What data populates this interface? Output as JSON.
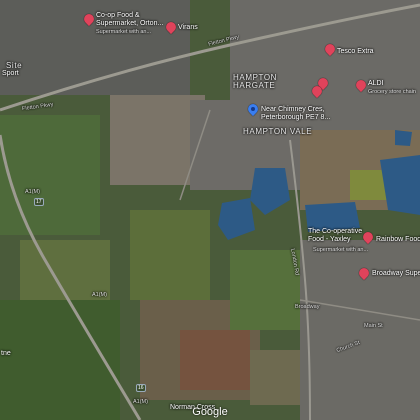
{
  "areas": {
    "hampton_hargate": "HAMPTON\nHARGATE",
    "hampton_vale": "HAMPTON VALE",
    "site": "Site",
    "ort_left": "tne",
    "norman_cross": "Norman Cross"
  },
  "roads": {
    "fletton_pkwy_n": "Fletton Pkwy",
    "fletton_pkwy_w": "Fletton Pkwy",
    "a1m_1": "A1(M)",
    "a1m_2": "A1(M)",
    "a1m_3": "A1(M)",
    "london_rd": "London Rd",
    "broadway": "Broadway",
    "main_st": "Main St",
    "church_st": "Church St",
    "shield_17": "17",
    "shield_16": "16"
  },
  "places": {
    "coop_orton": "Co-op Food &\nSupermarket, Orton...",
    "coop_orton_sub": "Supermarket with an...",
    "virans": "Virans",
    "tesco": "Tesco Extra",
    "aldi": "ALDI",
    "aldi_sub": "Grocery store chain",
    "coop_yaxley": "The Co-operative\nFood - Yaxley",
    "coop_yaxley_sub": "Supermarket with an...",
    "rainbow": "Rainbow Food",
    "broadway_super": "Broadway Supe",
    "sport": "Sport"
  },
  "selected_location": "Near Chimney Cres,\nPeterborough PE7 8...",
  "brand": "Google",
  "colors": {
    "pin_red": "#e0435b",
    "pin_blue": "#3a7ef0",
    "water": "#2d5a86"
  },
  "icons": [
    "shopping-bag-icon",
    "location-pin-icon"
  ]
}
